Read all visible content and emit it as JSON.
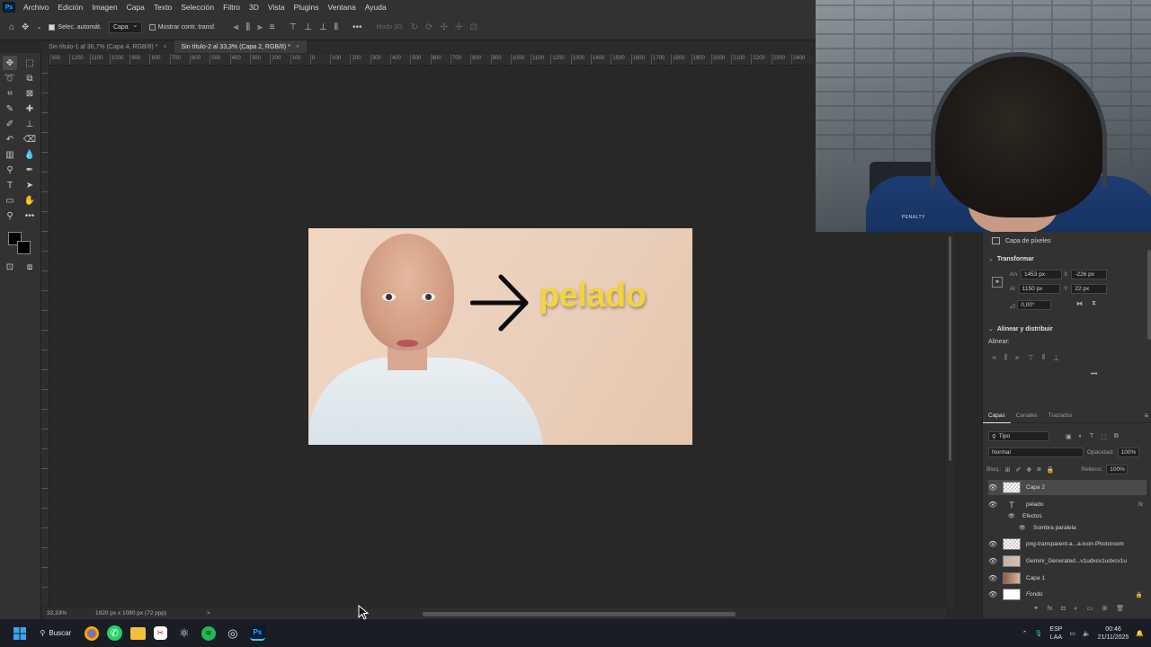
{
  "menubar": {
    "logo": "Ps",
    "items": [
      "Archivo",
      "Edición",
      "Imagen",
      "Capa",
      "Texto",
      "Selección",
      "Filtro",
      "3D",
      "Vista",
      "Plugins",
      "Ventana",
      "Ayuda"
    ]
  },
  "options": {
    "autoselect_label": "Selec. automát.",
    "layer_select": "Capa",
    "transform_label": "Mostrar contr. transf.",
    "mode3d_label": "Modo 3D:"
  },
  "tabs": [
    {
      "label": "Sin título-1 al 36,7% (Capa 4, RGB/8) *",
      "close": "×"
    },
    {
      "label": "Sin título-2 al 33,3% (Capa 2, RGB/8) *",
      "close": "×"
    }
  ],
  "ruler_ticks": [
    "300",
    "1200",
    "1100",
    "1000",
    "900",
    "800",
    "700",
    "600",
    "500",
    "400",
    "300",
    "200",
    "100",
    "0",
    "100",
    "200",
    "300",
    "400",
    "500",
    "600",
    "700",
    "800",
    "900",
    "1000",
    "1100",
    "1200",
    "1300",
    "1400",
    "1500",
    "1600",
    "1700",
    "1800",
    "1900",
    "2000",
    "2100",
    "2200",
    "2300",
    "2400"
  ],
  "document": {
    "headline": "pelado"
  },
  "status": {
    "zoom": "33,33%",
    "dims": "1920 px x 1080 px (72 ppp)",
    "arrow": ">"
  },
  "properties": {
    "kind_label": "Capa de píxeles",
    "transform_title": "Transformar",
    "w_label": "An",
    "w_value": "1453 px",
    "x_label": "X",
    "x_value": "-226 px",
    "h_label": "Al",
    "h_value": "1150 px",
    "y_label": "Y",
    "y_value": "22 px",
    "angle_value": "0,00°",
    "align_title": "Alinear y distribuir",
    "align_label": "Alinear:",
    "more": "•••"
  },
  "layers_panel": {
    "tabs": [
      "Capas",
      "Canales",
      "Trazados"
    ],
    "filter_label": "Tipo",
    "blend_mode": "Normal",
    "opacity_label": "Opacidad:",
    "opacity_value": "100%",
    "lock_label": "Bloq.:",
    "fill_label": "Relleno:",
    "fill_value": "100%",
    "layers": [
      {
        "name": "Capa 2",
        "thumb": "checker",
        "selected": true
      },
      {
        "name": "pelado",
        "thumb": "text",
        "fx": "fx"
      },
      {
        "name": "Efectos",
        "sub": true
      },
      {
        "name": "Sombra paralela",
        "sub2": true
      },
      {
        "name": "png-transparent-a...a-icon-Photoroom",
        "thumb": "checker"
      },
      {
        "name": "Gemini_Generated...v1udxcv1udxcv1u",
        "thumb": "photo1"
      },
      {
        "name": "Capa 1",
        "thumb": "photo2"
      },
      {
        "name": "Fondo",
        "thumb": "white",
        "italic": true
      }
    ]
  },
  "taskbar": {
    "search_label": "Buscar",
    "lang_top": "ESP",
    "lang_bottom": "LAA",
    "time": "00:46",
    "date": "21/11/2025"
  },
  "webcam": {
    "logo_text": "PENALTY"
  },
  "colors": {
    "ui_bg": "#323232",
    "canvas_bg": "#282828",
    "headline": "#f3d43b",
    "taskbar": "#1b1d24"
  }
}
